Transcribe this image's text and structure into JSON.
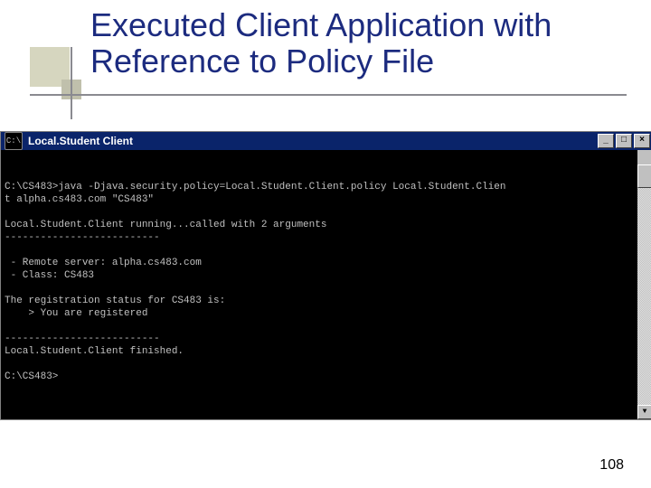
{
  "slide": {
    "title": "Executed Client Application with Reference to Policy File",
    "page_number": "108"
  },
  "console": {
    "window_title": "Local.Student Client",
    "sys_icon_text": "C:\\",
    "buttons": {
      "minimize": "_",
      "maximize": "□",
      "close": "×"
    },
    "lines": [
      "C:\\CS483>java -Djava.security.policy=Local.Student.Client.policy Local.Student.Clien",
      "t alpha.cs483.com \"CS483\"",
      "",
      "Local.Student.Client running...called with 2 arguments",
      "--------------------------",
      "",
      " - Remote server: alpha.cs483.com",
      " - Class: CS483",
      "",
      "The registration status for CS483 is:",
      "    > You are registered",
      "",
      "--------------------------",
      "Local.Student.Client finished.",
      "",
      "C:\\CS483>"
    ]
  }
}
